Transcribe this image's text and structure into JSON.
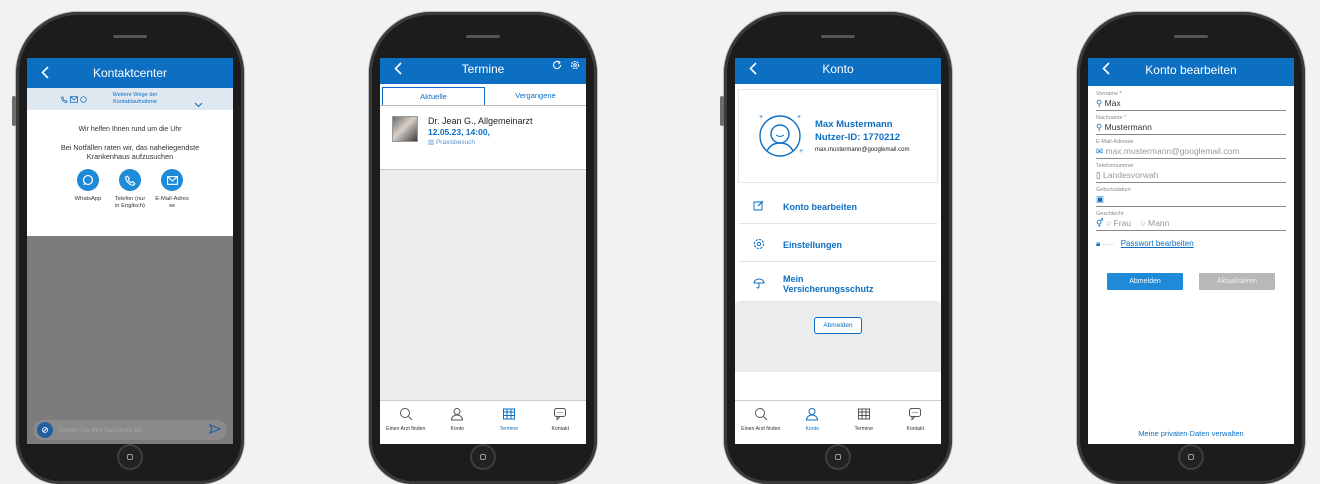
{
  "phone1": {
    "header_title": "Kontaktcenter",
    "more_ways": "Weitere Wege der Kontaktaufnahme",
    "help_text": "Wir helfen Ihnen rund um die Uhr",
    "emergency_text": "Bei Notfällen raten wir, das naheliegendste Krankenhaus aufzusuchen",
    "contacts": [
      {
        "label": "WhatsApp",
        "icon": "whatsapp-icon"
      },
      {
        "label": "Telefon (nur in Englisch)",
        "icon": "phone-icon"
      },
      {
        "label": "E-Mail-Adres se",
        "icon": "mail-icon"
      }
    ],
    "message_placeholder": "Geben Sie Ihre Nachricht ein..."
  },
  "phone2": {
    "header_title": "Termine",
    "tabs": [
      "Aktuelle",
      "Vergangene"
    ],
    "appointment": {
      "doctor": "Dr. Jean G., Allgemeinarzt",
      "datetime": "12.05.23, 14:00,",
      "type": "Praxisbesuch"
    }
  },
  "phone3": {
    "header_title": "Konto",
    "name": "Max Mustermann",
    "user_id": "Nutzer-ID: 1770212",
    "email": "max.mustermann@googlemail.com",
    "menu": [
      "Konto bearbeiten",
      "Einstellungen",
      "Mein Versicherungsschutz"
    ],
    "logout": "Abmelden"
  },
  "phone4": {
    "header_title": "Konto bearbeiten",
    "fields": [
      {
        "label": "Vorname *",
        "value": "Max"
      },
      {
        "label": "Nachname *",
        "value": "Mustermann"
      },
      {
        "label": "E-Mail-Adresse",
        "value": "max.mustermann@googlemail.com"
      },
      {
        "label": "Telefonnummer",
        "value": "Landesvorwah"
      },
      {
        "label": "Geburtsdatum",
        "value": ""
      },
      {
        "label": "Geschlecht",
        "value": ""
      }
    ],
    "gender_options": [
      "Frau",
      "Mann"
    ],
    "password_dots": "······",
    "password_link": "Passwort bearbeiten",
    "logout": "Abmelden",
    "update": "Aktualisieren",
    "privacy_link": "Meine privaten Daten verwalten"
  },
  "tabbar": [
    "Einen Arzt finden",
    "Konto",
    "Termine",
    "Kontakt"
  ],
  "colors": {
    "accent": "#0d6fc2",
    "whatsapp": "#1f8ad8",
    "background": "#f2f2f2"
  }
}
